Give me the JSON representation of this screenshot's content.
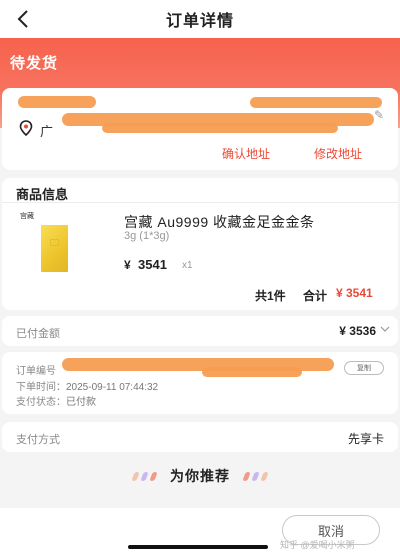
{
  "header": {
    "title": "订单详情",
    "back_icon": "chevron-left-icon"
  },
  "status": {
    "text": "待发货"
  },
  "address": {
    "prefix": "广",
    "confirm_label": "确认地址",
    "modify_label": "修改地址",
    "icon": "location-pin-icon"
  },
  "goods": {
    "section_title": "商品信息",
    "brand": "宫藏",
    "name": "宫藏 Au9999 收藏金足金金条",
    "spec": "3g (1*3g)",
    "price_symbol": "¥",
    "price": "3541",
    "qty": "x1",
    "total_count": "共1件",
    "total_label": "合计",
    "total_amount": "¥ 3541"
  },
  "paid": {
    "label": "已付金额",
    "value": "¥ 3536"
  },
  "order": {
    "number_label": "订单编号",
    "copy_label": "复制",
    "time_label": "下单时间：",
    "time_value": "2025-09-11 07:44:32",
    "pay_status_label": "支付状态：",
    "pay_status_value": "已付款"
  },
  "payment": {
    "label": "支付方式",
    "value": "先享卡"
  },
  "recommend": {
    "title": "为你推荐"
  },
  "bottom": {
    "cancel_label": "取消",
    "watermark": "知乎 @爱喝小米粥"
  },
  "colors": {
    "accent": "#ea4a36",
    "banner": "#f6624d",
    "gold": "#edc42c",
    "redaction": "#f79d52"
  }
}
